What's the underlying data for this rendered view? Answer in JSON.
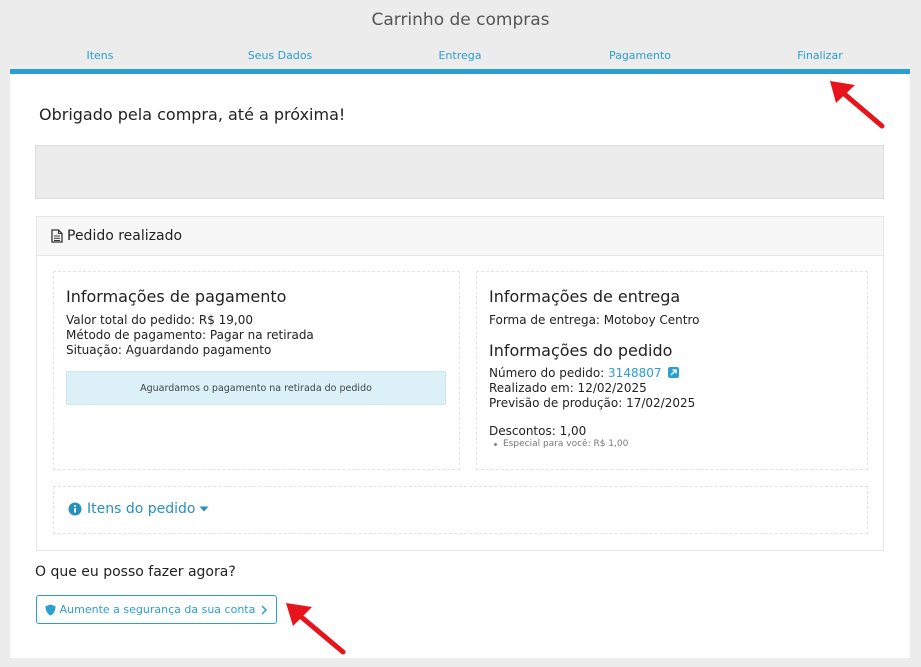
{
  "header": {
    "title": "Carrinho de compras"
  },
  "steps": [
    "Itens",
    "Seus Dados",
    "Entrega",
    "Pagamento",
    "Finalizar"
  ],
  "thanks": "Obrigado pela compra, até a próxima!",
  "order": {
    "title": "Pedido realizado",
    "payment": {
      "title": "Informações de pagamento",
      "total": "Valor total do pedido: R$ 19,00",
      "method": "Método de pagamento: Pagar na retirada",
      "status": "Situação: Aguardando pagamento",
      "alert": "Aguardamos o pagamento na retirada do pedido"
    },
    "delivery": {
      "title": "Informações de entrega",
      "method": "Forma de entrega: Motoboy Centro"
    },
    "details": {
      "title": "Informações do pedido",
      "number_label": "Número do pedido:",
      "number": "3148807",
      "placed": "Realizado em: 12/02/2025",
      "production": "Previsão de produção: 17/02/2025",
      "discounts": "Descontos: 1,00",
      "discount_item": "Especial para você: R$ 1,00"
    },
    "items_toggle": "Itens do pedido"
  },
  "next": {
    "question": "O que eu posso fazer agora?",
    "security_button": "Aumente a segurança da sua conta"
  },
  "colors": {
    "accent": "#2a9fd0",
    "annotation": "#e8141b"
  },
  "icons": [
    "document-icon",
    "external-link-icon",
    "info-icon",
    "caret-down-icon",
    "shield-icon",
    "chevron-right-icon"
  ]
}
